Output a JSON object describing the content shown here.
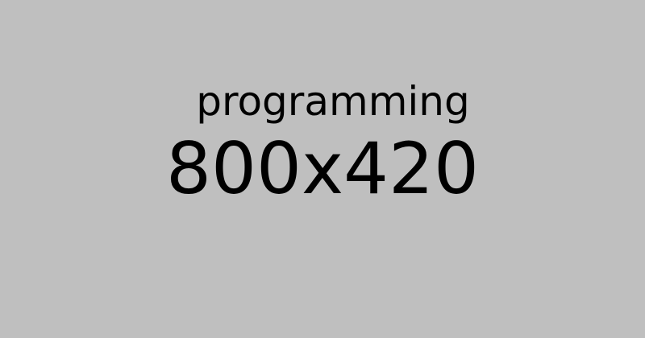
{
  "placeholder": {
    "label": "programming",
    "dimensions": "800x420",
    "background_color": "#bfbfbf",
    "text_color": "#000000"
  }
}
